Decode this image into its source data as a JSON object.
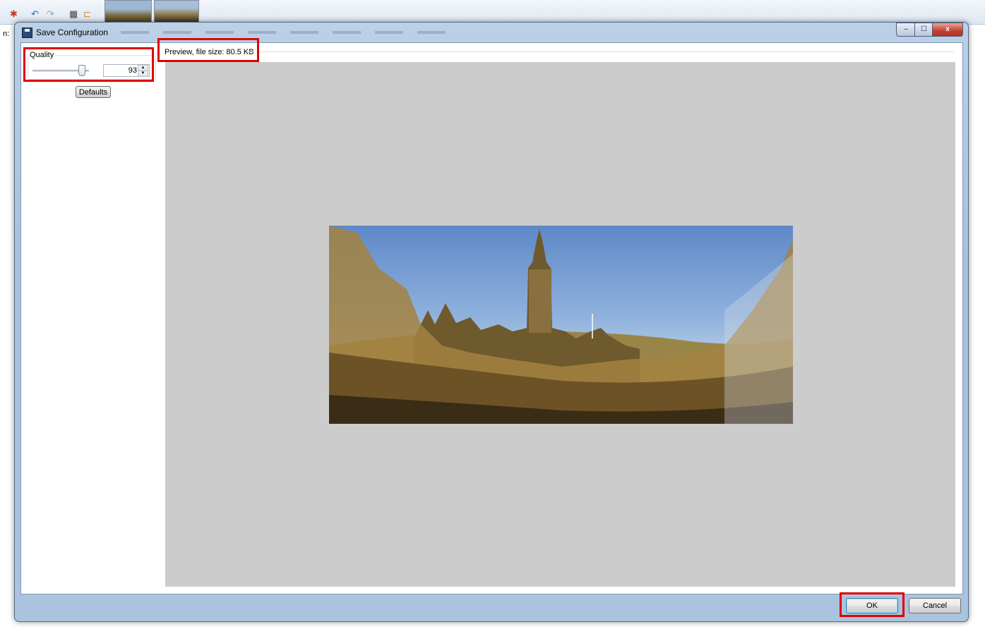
{
  "host": {
    "side_label": "n:"
  },
  "dialog": {
    "title": "Save Configuration",
    "caption_buttons": {
      "minimize": "–",
      "maximize": "☐",
      "close": "x"
    }
  },
  "quality": {
    "label": "Quality",
    "value": "93",
    "slider_level_percent": 93,
    "defaults_label": "Defaults"
  },
  "preview": {
    "label": "Preview, file size: 80.5 KB"
  },
  "footer": {
    "ok_label": "OK",
    "cancel_label": "Cancel"
  },
  "colors": {
    "highlight": "#e10000",
    "preview_background": "#cccccc"
  }
}
